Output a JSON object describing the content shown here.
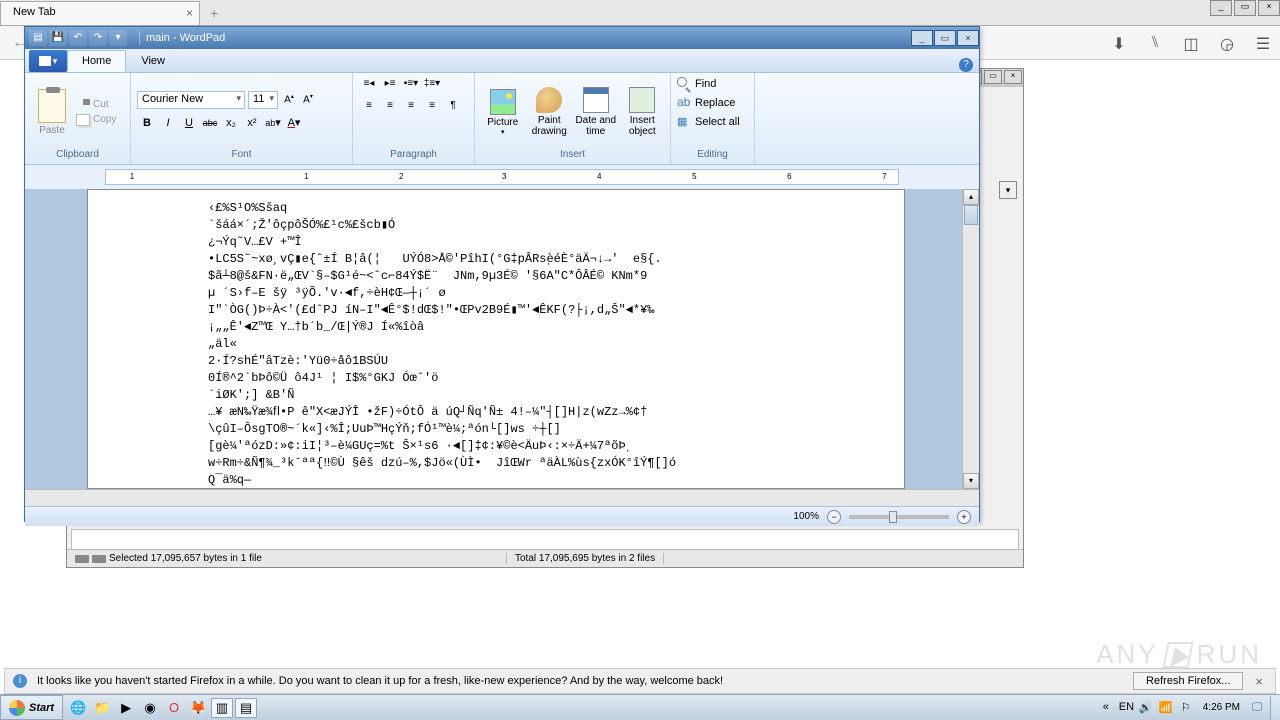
{
  "browser": {
    "tab_title": "New Tab",
    "notif_text": "It looks like you haven't started Firefox in a while. Do you want to clean it up for a fresh, like-new experience? And by the way, welcome back!",
    "notif_button": "Refresh Firefox...",
    "toolbar_icons": [
      "downloads-icon",
      "library-icon",
      "sidebar-icon",
      "account-icon",
      "menu-icon"
    ]
  },
  "wordpad": {
    "title": "main - WordPad",
    "tabs": {
      "home": "Home",
      "view": "View"
    },
    "clipboard": {
      "paste": "Paste",
      "cut": "Cut",
      "copy": "Copy",
      "label": "Clipboard"
    },
    "font": {
      "name": "Courier New",
      "size": "11",
      "grow": "A^",
      "shrink": "A˅",
      "bold": "B",
      "italic": "I",
      "underline": "U",
      "strike": "abc",
      "sub": "x₂",
      "sup": "x²",
      "label": "Font"
    },
    "paragraph": {
      "label": "Paragraph"
    },
    "insert": {
      "picture": "Picture",
      "paint": "Paint drawing",
      "date": "Date and time",
      "object": "Insert object",
      "label": "Insert"
    },
    "editing": {
      "find": "Find",
      "replace": "Replace",
      "select": "Select all",
      "label": "Editing"
    },
    "ruler_marks": [
      "1",
      "1",
      "2",
      "3",
      "4",
      "5",
      "6",
      "7"
    ],
    "document_lines": [
      "‹£%S¹O%Sšaq",
      "`šáá×´;Ž'ôçpôŠÓ%£¹c%£šcb▮Ó",
      "¿¬Ýq˜V…£V +™Î",
      "•LC5S˜~xø¸vÇ▮e{ˆ±Í B¦â(¦   UÝÓ8>Å©'PîhI(°G‡pÂRsͺèéÈ°äÄ¬↓→'  e§{.",
      "$ã┴8@š&FN·ë„ŒV`§–$G¹é~<ˆc⌐84Ý$Ë¨  JNm,9µ3É© '§6A\"C*ÔÂÉ© KNm*9",
      "µ ´S›f–E šÿ ³ÿÕ.'v·◄f,÷èH¢Œ—┼¡´ ø",
      "I\"`ÒG()Þ÷À<'(£dˆPJ íN–I\"◄Ê°$!dŒ$!\"•ŒPv2B9É▮™'◄ÊKF(?├¡,d„Š\"◄*¥‰",
      "¡„„Ê'◄Z™Œ Y…†b´b_/Œ|Ý®J Í«%îòâ",
      "„äl«",
      "2·Í?shÉ\"âTzè:'Yü0÷åô1BSÚU",
      "0Í®^2`bÞô©Ü ô4J¹ ¦ I$%°GKJ Óœˆ'ö",
      "´iØK';] &B'Ñ",
      "…¥ æN‰Ÿæ¾ﬂ•P ê\"X<æJÝÎ •žF)÷ÓtÔ ä úQ┘Ñq'Ñ± 4!–¼\"┤[]H|z(wZz→%¢†",
      "\\çûI–ÔsgTO®~´k«]‹%Î;UuÞ™HçÝň;fÓ¹™è¼;ªón└[]ws ÷┼[]",
      "[gè¼'ªózD:»¢:iI¦³–è¼GUç=%t Š×¹s6 ·◄[]‡¢:¥©è<ÄuÞ‹:×÷Ä+¼7ªõÞͺ",
      "w÷Rm÷&Ñ¶¾_³kˉªª{‼©Ù §êš dzú–%,$Jö«(ÙÌ•  JîŒWr ªäÀL%ùs{zxÓK°îÝ¶[]ó",
      "Q¯ä%q—"
    ],
    "zoom": "100%"
  },
  "filemanager": {
    "selected": "Selected 17,095,657 bytes in 1 file",
    "total": "Total 17,095,695 bytes in 2 files"
  },
  "taskbar": {
    "start": "Start",
    "clock": "4:26 PM"
  },
  "watermark": {
    "text1": "ANY",
    "text2": "RUN"
  }
}
